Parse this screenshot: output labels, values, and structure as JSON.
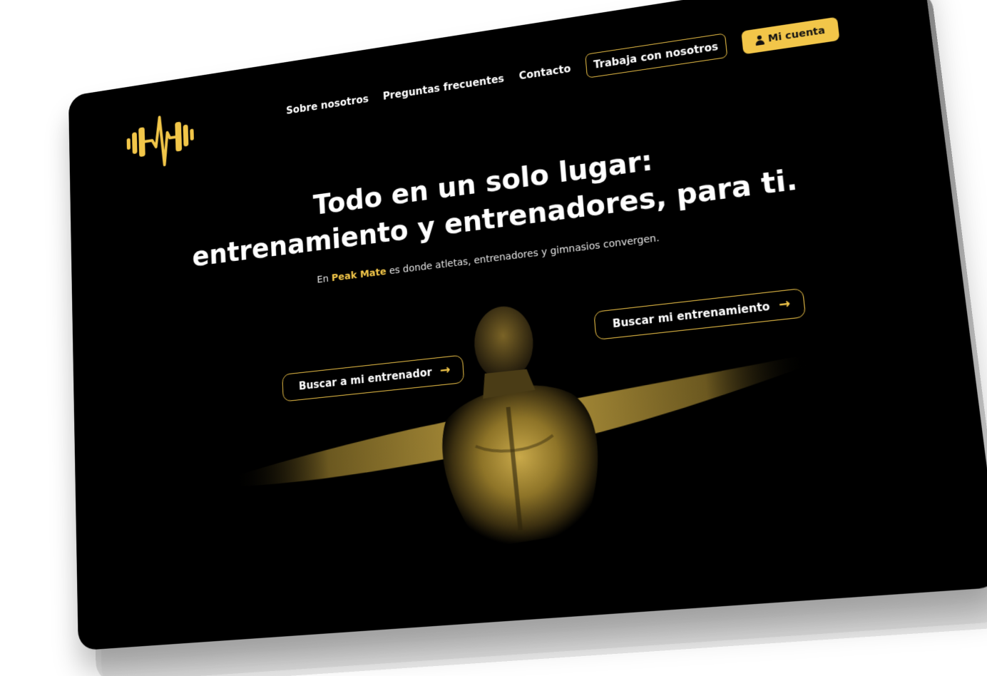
{
  "nav": {
    "items": [
      {
        "label": "Sobre nosotros"
      },
      {
        "label": "Preguntas frecuentes"
      },
      {
        "label": "Contacto"
      }
    ],
    "work_with_us": "Trabaja con nosotros",
    "account": {
      "label": "Mi cuenta",
      "icon": "user-icon"
    }
  },
  "logo": {
    "icon": "dumbbell-heartbeat-logo",
    "color": "#f2c649"
  },
  "hero": {
    "title_line1": "Todo en un solo lugar:",
    "title_line2": "entrenamiento y entrenadores, para ti.",
    "subtitle_prefix": "En",
    "subtitle_brand": "Peak Mate",
    "subtitle_suffix": "es donde atletas, entrenadores y gimnasios convergen."
  },
  "cta": {
    "find_trainer": "Buscar a mi entrenador",
    "find_training": "Buscar mi entrenamiento",
    "arrow_icon": "arrow-right-icon"
  },
  "colors": {
    "accent": "#f2c649",
    "background": "#000000",
    "text": "#ffffff"
  }
}
